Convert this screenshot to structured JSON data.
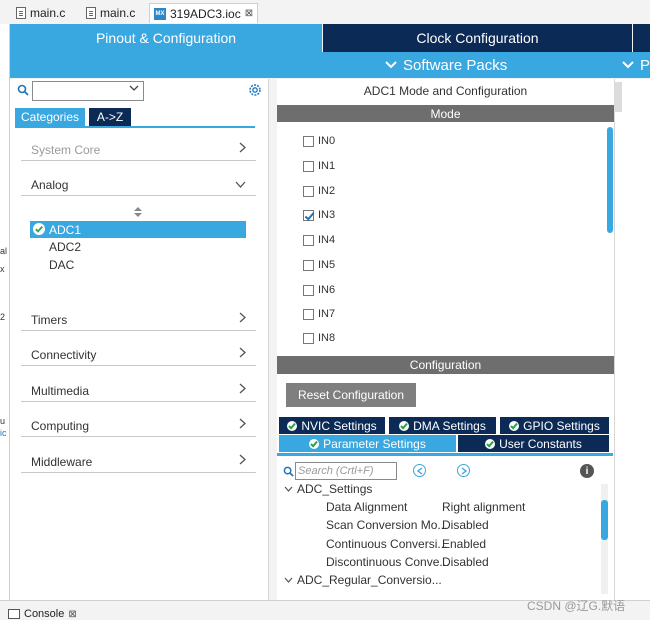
{
  "editor_tabs": [
    {
      "label": "main.c"
    },
    {
      "label": "main.c"
    },
    {
      "label": "319ADC3.ioc",
      "close": "⊠"
    }
  ],
  "nav": {
    "pinout": "Pinout & Configuration",
    "clock": "Clock Configuration",
    "software_packs": "Software Packs",
    "pinout_trunc": "P"
  },
  "left": {
    "tab_categories": "Categories",
    "tab_az": "A->Z",
    "categories": [
      {
        "label": "System Core",
        "disabled": true,
        "chevron": ">"
      },
      {
        "label": "Analog",
        "chevron": "v"
      },
      {
        "label": "Timers",
        "chevron": ">"
      },
      {
        "label": "Connectivity",
        "chevron": ">"
      },
      {
        "label": "Multimedia",
        "chevron": ">"
      },
      {
        "label": "Computing",
        "chevron": ">"
      },
      {
        "label": "Middleware",
        "chevron": ">"
      }
    ],
    "peripherals": [
      "ADC1",
      "ADC2",
      "DAC"
    ]
  },
  "mode": {
    "title": "ADC1 Mode and Configuration",
    "header": "Mode",
    "channels": [
      {
        "label": "IN0",
        "checked": false
      },
      {
        "label": "IN1",
        "checked": false
      },
      {
        "label": "IN2",
        "checked": false
      },
      {
        "label": "IN3",
        "checked": true
      },
      {
        "label": "IN4",
        "checked": false
      },
      {
        "label": "IN5",
        "checked": false
      },
      {
        "label": "IN6",
        "checked": false
      },
      {
        "label": "IN7",
        "checked": false
      },
      {
        "label": "IN8",
        "checked": false
      }
    ]
  },
  "config": {
    "header": "Configuration",
    "reset_button": "Reset Configuration",
    "tabs_row1": [
      "NVIC Settings",
      "DMA Settings",
      "GPIO Settings"
    ],
    "tabs_row2": [
      "Parameter Settings",
      "User Constants"
    ],
    "search_placeholder": "Search (Crtl+F)",
    "tree": {
      "group1": "ADC_Settings",
      "rows": [
        {
          "name": "Data Alignment",
          "value": "Right alignment"
        },
        {
          "name": "Scan Conversion Mo...",
          "value": "Disabled"
        },
        {
          "name": "Continuous Conversi...",
          "value": "Enabled"
        },
        {
          "name": "Discontinuous Conve...",
          "value": "Disabled"
        }
      ],
      "group2": "ADC_Regular_Conversio..."
    }
  },
  "bottom": {
    "console": "Console",
    "console_close": "⊠",
    "watermark": "CSDN @辽G.默语"
  },
  "left_edge_chars": [
    "al",
    "x",
    "2",
    "u",
    "ic"
  ],
  "colors": {
    "accent": "#39a7e0",
    "dark_nav": "#0c2a56",
    "section_header": "#6e6e6e"
  }
}
